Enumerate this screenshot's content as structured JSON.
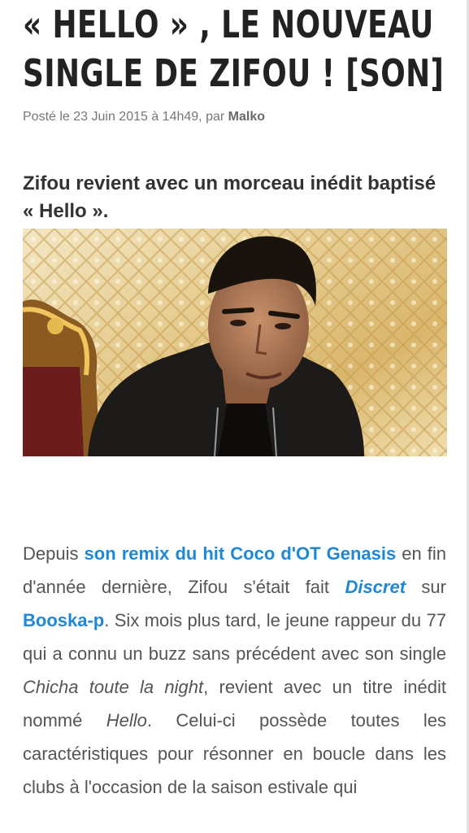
{
  "article": {
    "title_line1": "« HELLO » , LE NOUVEAU",
    "title_line2": "SINGLE DE ZIFOU ! [SON]",
    "meta_prefix": "Posté le 23 Juin 2015 à 14h49, par",
    "author": "Malko",
    "lead": "Zifou revient avec un morceau inédit baptisé « Hello ».",
    "image_alt": "Zifou portrait",
    "body": {
      "t1": "Depuis ",
      "link1": "son remix du hit Coco d'OT Genasis",
      "t2": " en fin d'année dernière, Zifou s'était fait ",
      "link2": "Discret",
      "t3": " sur ",
      "link3": "Booska-p",
      "t4": ". Six mois plus tard, le jeune rappeur du 77 qui a connu un buzz sans précédent avec son single ",
      "em1": "Chicha toute la night",
      "t5": ", revient avec un titre inédit nommé ",
      "em2": "Hello",
      "t6": ". Celui-ci possède toutes les caractéristiques pour résonner en boucle dans les clubs à l'occasion de la saison estivale qui"
    }
  },
  "colors": {
    "link": "#1e88d8",
    "title": "#222222",
    "body": "#555555"
  }
}
